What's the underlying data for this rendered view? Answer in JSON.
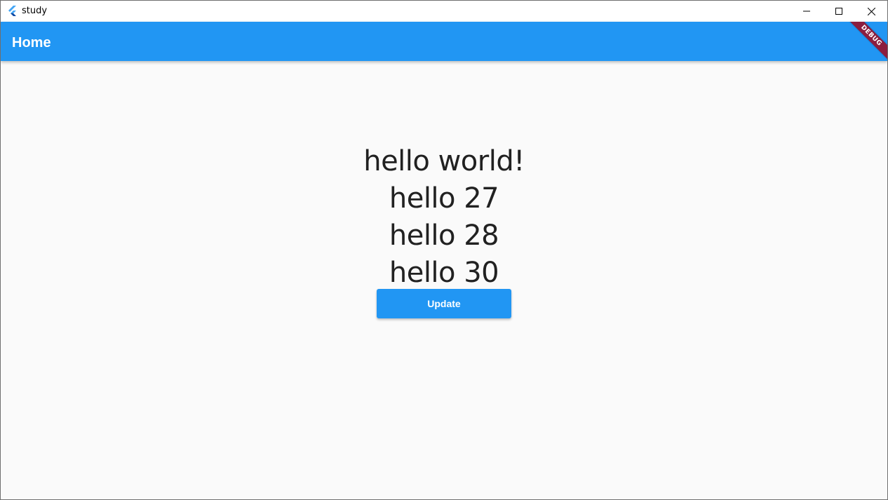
{
  "window": {
    "title": "study",
    "controls": {
      "minimize_icon": "minimize-icon",
      "maximize_icon": "maximize-icon",
      "close_icon": "close-icon"
    }
  },
  "appbar": {
    "title": "Home",
    "color": "#2196f3",
    "debug_banner": "DEBUG"
  },
  "main": {
    "lines": [
      "hello world!",
      "hello 27",
      "hello 28",
      "hello 30"
    ],
    "button_label": "Update",
    "button_color": "#2196f3"
  }
}
